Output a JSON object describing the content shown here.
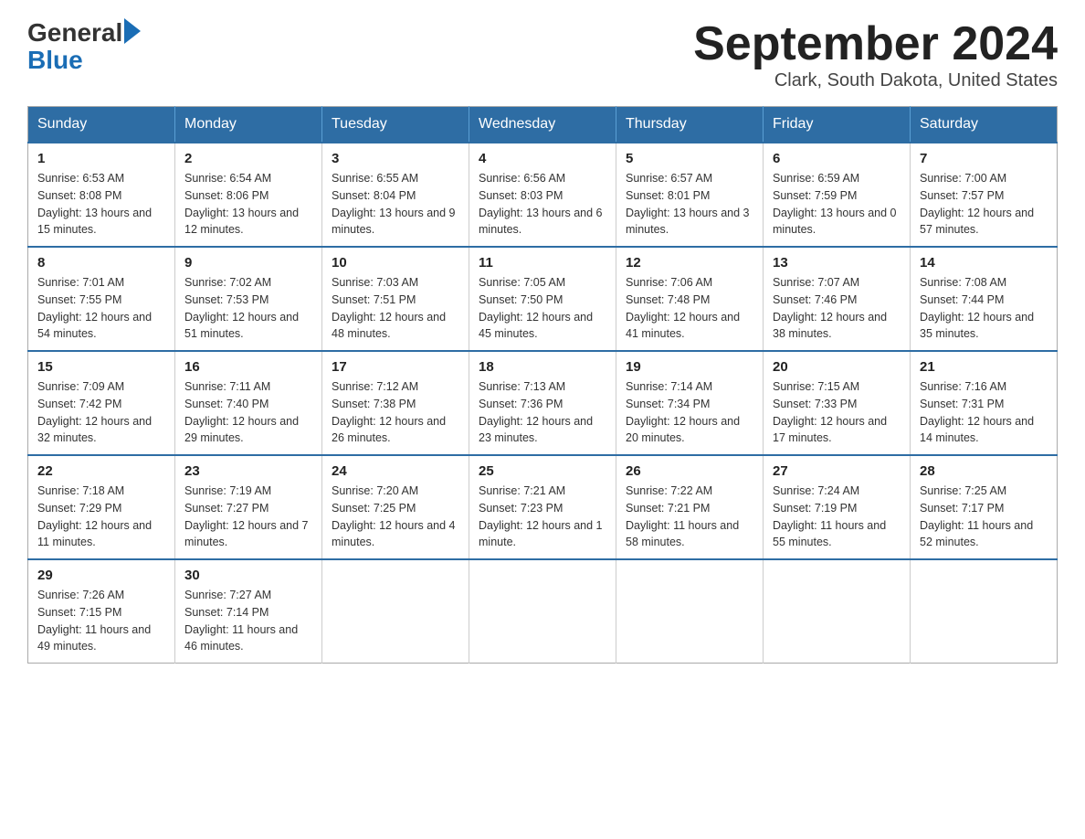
{
  "logo": {
    "text_general": "General",
    "text_blue": "Blue",
    "arrow": true
  },
  "title": {
    "month_year": "September 2024",
    "location": "Clark, South Dakota, United States"
  },
  "days_of_week": [
    "Sunday",
    "Monday",
    "Tuesday",
    "Wednesday",
    "Thursday",
    "Friday",
    "Saturday"
  ],
  "weeks": [
    [
      {
        "day": "1",
        "sunrise": "6:53 AM",
        "sunset": "8:08 PM",
        "daylight": "13 hours and 15 minutes."
      },
      {
        "day": "2",
        "sunrise": "6:54 AM",
        "sunset": "8:06 PM",
        "daylight": "13 hours and 12 minutes."
      },
      {
        "day": "3",
        "sunrise": "6:55 AM",
        "sunset": "8:04 PM",
        "daylight": "13 hours and 9 minutes."
      },
      {
        "day": "4",
        "sunrise": "6:56 AM",
        "sunset": "8:03 PM",
        "daylight": "13 hours and 6 minutes."
      },
      {
        "day": "5",
        "sunrise": "6:57 AM",
        "sunset": "8:01 PM",
        "daylight": "13 hours and 3 minutes."
      },
      {
        "day": "6",
        "sunrise": "6:59 AM",
        "sunset": "7:59 PM",
        "daylight": "13 hours and 0 minutes."
      },
      {
        "day": "7",
        "sunrise": "7:00 AM",
        "sunset": "7:57 PM",
        "daylight": "12 hours and 57 minutes."
      }
    ],
    [
      {
        "day": "8",
        "sunrise": "7:01 AM",
        "sunset": "7:55 PM",
        "daylight": "12 hours and 54 minutes."
      },
      {
        "day": "9",
        "sunrise": "7:02 AM",
        "sunset": "7:53 PM",
        "daylight": "12 hours and 51 minutes."
      },
      {
        "day": "10",
        "sunrise": "7:03 AM",
        "sunset": "7:51 PM",
        "daylight": "12 hours and 48 minutes."
      },
      {
        "day": "11",
        "sunrise": "7:05 AM",
        "sunset": "7:50 PM",
        "daylight": "12 hours and 45 minutes."
      },
      {
        "day": "12",
        "sunrise": "7:06 AM",
        "sunset": "7:48 PM",
        "daylight": "12 hours and 41 minutes."
      },
      {
        "day": "13",
        "sunrise": "7:07 AM",
        "sunset": "7:46 PM",
        "daylight": "12 hours and 38 minutes."
      },
      {
        "day": "14",
        "sunrise": "7:08 AM",
        "sunset": "7:44 PM",
        "daylight": "12 hours and 35 minutes."
      }
    ],
    [
      {
        "day": "15",
        "sunrise": "7:09 AM",
        "sunset": "7:42 PM",
        "daylight": "12 hours and 32 minutes."
      },
      {
        "day": "16",
        "sunrise": "7:11 AM",
        "sunset": "7:40 PM",
        "daylight": "12 hours and 29 minutes."
      },
      {
        "day": "17",
        "sunrise": "7:12 AM",
        "sunset": "7:38 PM",
        "daylight": "12 hours and 26 minutes."
      },
      {
        "day": "18",
        "sunrise": "7:13 AM",
        "sunset": "7:36 PM",
        "daylight": "12 hours and 23 minutes."
      },
      {
        "day": "19",
        "sunrise": "7:14 AM",
        "sunset": "7:34 PM",
        "daylight": "12 hours and 20 minutes."
      },
      {
        "day": "20",
        "sunrise": "7:15 AM",
        "sunset": "7:33 PM",
        "daylight": "12 hours and 17 minutes."
      },
      {
        "day": "21",
        "sunrise": "7:16 AM",
        "sunset": "7:31 PM",
        "daylight": "12 hours and 14 minutes."
      }
    ],
    [
      {
        "day": "22",
        "sunrise": "7:18 AM",
        "sunset": "7:29 PM",
        "daylight": "12 hours and 11 minutes."
      },
      {
        "day": "23",
        "sunrise": "7:19 AM",
        "sunset": "7:27 PM",
        "daylight": "12 hours and 7 minutes."
      },
      {
        "day": "24",
        "sunrise": "7:20 AM",
        "sunset": "7:25 PM",
        "daylight": "12 hours and 4 minutes."
      },
      {
        "day": "25",
        "sunrise": "7:21 AM",
        "sunset": "7:23 PM",
        "daylight": "12 hours and 1 minute."
      },
      {
        "day": "26",
        "sunrise": "7:22 AM",
        "sunset": "7:21 PM",
        "daylight": "11 hours and 58 minutes."
      },
      {
        "day": "27",
        "sunrise": "7:24 AM",
        "sunset": "7:19 PM",
        "daylight": "11 hours and 55 minutes."
      },
      {
        "day": "28",
        "sunrise": "7:25 AM",
        "sunset": "7:17 PM",
        "daylight": "11 hours and 52 minutes."
      }
    ],
    [
      {
        "day": "29",
        "sunrise": "7:26 AM",
        "sunset": "7:15 PM",
        "daylight": "11 hours and 49 minutes."
      },
      {
        "day": "30",
        "sunrise": "7:27 AM",
        "sunset": "7:14 PM",
        "daylight": "11 hours and 46 minutes."
      },
      null,
      null,
      null,
      null,
      null
    ]
  ],
  "labels": {
    "sunrise": "Sunrise:",
    "sunset": "Sunset:",
    "daylight": "Daylight:"
  }
}
